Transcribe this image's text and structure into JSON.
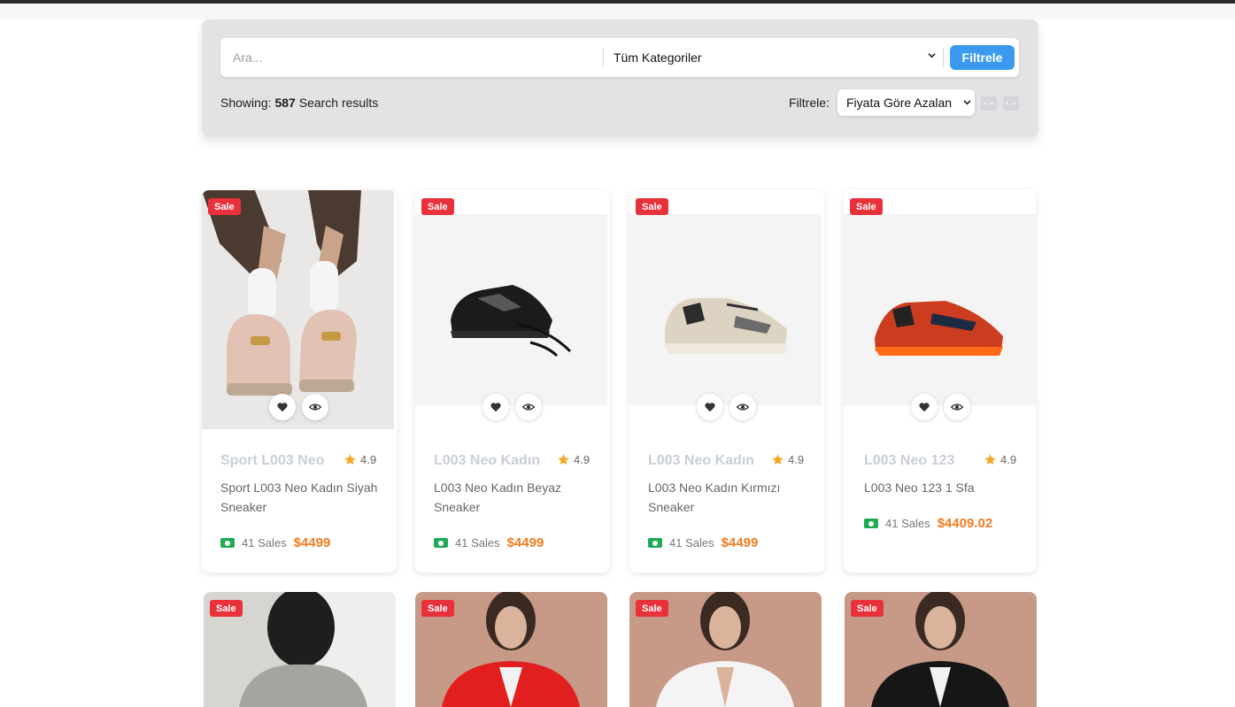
{
  "search": {
    "placeholder": "Ara...",
    "category": "Tüm Kategoriler",
    "button": "Filtrele"
  },
  "results": {
    "prefix": "Showing:",
    "count": "587",
    "suffix": "Search results"
  },
  "sort": {
    "label": "Filtrele:",
    "selected": "Fiyata Göre Azalan"
  },
  "badge": "Sale",
  "products": [
    {
      "name": "Sport L003 Neo",
      "rating": "4.9",
      "desc": "Sport L003 Neo Kadın Siyah Sneaker",
      "sales": "41 Sales",
      "price": "$4499"
    },
    {
      "name": "L003 Neo Kadın",
      "rating": "4.9",
      "desc": "L003 Neo Kadın Beyaz Sneaker",
      "sales": "41 Sales",
      "price": "$4499"
    },
    {
      "name": "L003 Neo Kadın",
      "rating": "4.9",
      "desc": "L003 Neo Kadın Kırmızı Sneaker",
      "sales": "41 Sales",
      "price": "$4499"
    },
    {
      "name": "L003 Neo 123",
      "rating": "4.9",
      "desc": "L003 Neo 123 1 Sfa",
      "sales": "41 Sales",
      "price": "$4409.02"
    }
  ],
  "colors": {
    "accent": "#3b9af0",
    "sale": "#e8313b",
    "price": "#f47b20",
    "star": "#f5a623"
  }
}
